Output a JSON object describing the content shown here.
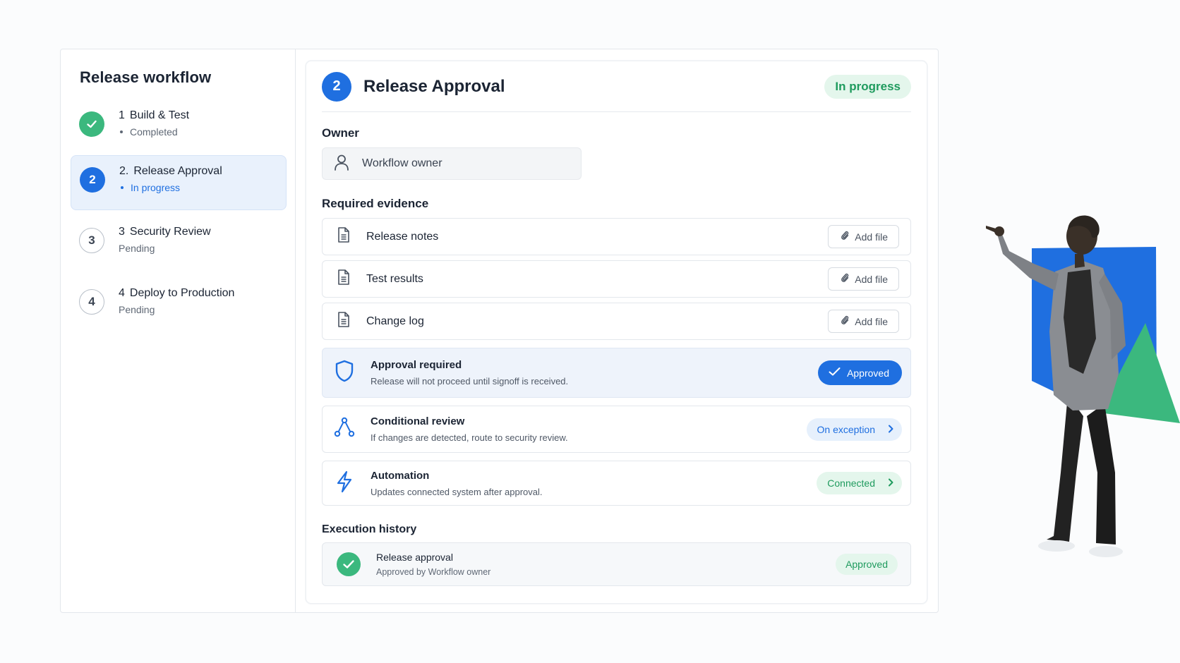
{
  "sidebar": {
    "title": "Release workflow",
    "steps": [
      {
        "number": "1",
        "num_label": "1",
        "label": "Build & Test",
        "status": "Completed",
        "state": "done"
      },
      {
        "number": "2",
        "num_label": "2.",
        "label": "Release Approval",
        "status": "In progress",
        "state": "active"
      },
      {
        "number": "3",
        "num_label": "3",
        "label": "Security Review",
        "status": "Pending",
        "state": "pending"
      },
      {
        "number": "4",
        "num_label": "4",
        "label": "Deploy to Production",
        "status": "Pending",
        "state": "pending"
      }
    ]
  },
  "main": {
    "step_number": "2",
    "title": "Release Approval",
    "status": "In progress",
    "owner_label": "Owner",
    "owner_value": "Workflow owner",
    "evidence_label": "Required evidence",
    "evidence": [
      {
        "name": "Release notes",
        "action": "Add file"
      },
      {
        "name": "Test results",
        "action": "Add file"
      },
      {
        "name": "Change log",
        "action": "Add file"
      }
    ],
    "rules": [
      {
        "title": "Approval required",
        "description": "Release will not proceed until signoff is received.",
        "action": "Approved",
        "icon": "shield-icon"
      },
      {
        "title": "Conditional review",
        "description": "If changes are detected, route to security review.",
        "action": "On exception",
        "icon": "branch-icon"
      },
      {
        "title": "Automation",
        "description": "Updates connected system after approval.",
        "action": "Connected",
        "icon": "lightning-icon"
      }
    ],
    "history_label": "Execution history",
    "history": [
      {
        "title": "Release approval",
        "description": "Approved by Workflow owner",
        "status": "Approved"
      }
    ]
  },
  "colors": {
    "primary": "#1f6fe0",
    "success": "#3bb87e",
    "success_text": "#1f9b5e",
    "success_bg": "#e4f6ec",
    "active_bg": "#e9f1fc"
  }
}
